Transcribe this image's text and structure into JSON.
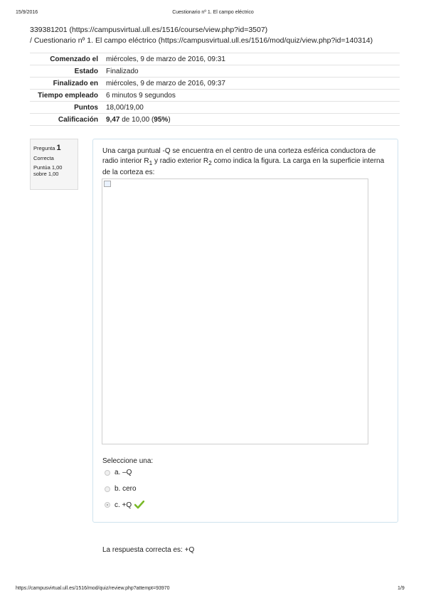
{
  "print_header": {
    "date": "15/9/2016",
    "title": "Cuestionario nº 1. El campo eléctrico"
  },
  "breadcrumb": {
    "line1": "339381201 (https://campusvirtual.ull.es/1516/course/view.php?id=3507)",
    "line2": "/  Cuestionario nº 1. El campo eléctrico (https://campusvirtual.ull.es/1516/mod/quiz/view.php?id=140314)"
  },
  "summary": [
    {
      "label": "Comenzado el",
      "value": "miércoles, 9 de marzo de 2016, 09:31"
    },
    {
      "label": "Estado",
      "value": "Finalizado"
    },
    {
      "label": "Finalizado en",
      "value": "miércoles, 9 de marzo de 2016, 09:37"
    },
    {
      "label": "Tiempo empleado",
      "value": "6 minutos 9 segundos"
    },
    {
      "label": "Puntos",
      "value": "18,00/19,00"
    }
  ],
  "grade": {
    "label": "Calificación",
    "score": "9,47",
    "of": "de 10,00 (",
    "percent": "95%",
    "close": ")"
  },
  "question_info": {
    "prefix": "Pregunta",
    "number": "1",
    "state": "Correcta",
    "mark": "Puntúa 1,00 sobre 1,00"
  },
  "question": {
    "text_a": "Una carga puntual -Q se encuentra en el centro de una corteza esférica conductora de radio interior R",
    "sub1": "1",
    "text_b": " y radio exterior R",
    "sub2": "2",
    "text_c": " como indica la figura. La carga en la superficie interna de la corteza es:",
    "prompt": "Seleccione una:",
    "options": [
      {
        "label": "a. –Q",
        "selected": false
      },
      {
        "label": "b. cero",
        "selected": false
      },
      {
        "label": "c. +Q",
        "selected": true,
        "correct": true
      }
    ]
  },
  "right_answer": "La respuesta correcta es: +Q",
  "print_footer": {
    "url": "https://campusvirtual.ull.es/1516/mod/quiz/review.php?attempt=93970",
    "page": "1/9"
  },
  "colors": {
    "check_green": "#7ab929",
    "box_border": "#cfe3ee"
  }
}
